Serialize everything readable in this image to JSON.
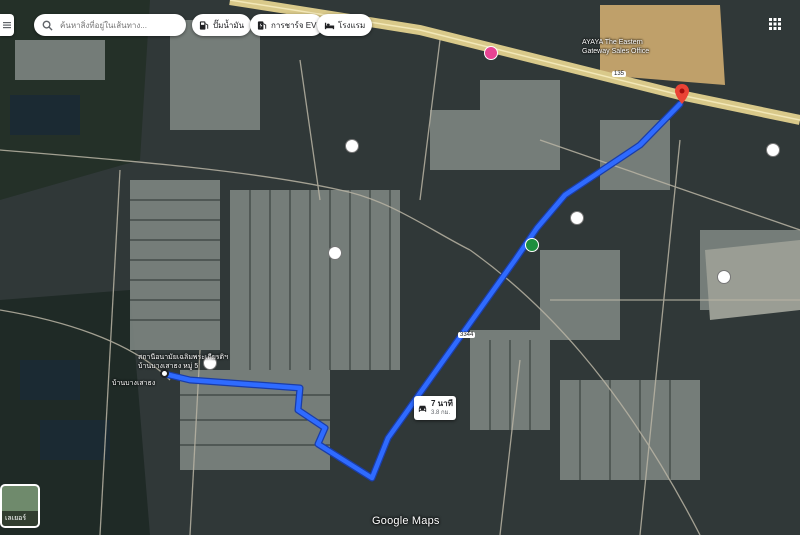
{
  "search": {
    "placeholder": "ค้นหาสิ่งที่อยู่ในเส้นทาง..."
  },
  "chips": [
    {
      "label": "ปั๊มน้ำมัน",
      "icon": "gas-station-icon"
    },
    {
      "label": "การชาร์จ EV",
      "icon": "ev-charger-icon"
    },
    {
      "label": "โรงแรม",
      "icon": "hotel-icon"
    }
  ],
  "route": {
    "duration": "7 นาที",
    "distance": "3.8 กม.",
    "color": "#2f6bff"
  },
  "labels": {
    "origin": "บ้านบางเสาธง",
    "origin_poi": "สถานีอนามัยเฉลิมพระเกียรติฯ",
    "origin_poi_sub": "บ้านบางเสาธง หมู่ 5",
    "destination_poi": "AYAYA The Eastern Gateway Sales Office",
    "highway_shield": "135",
    "road_3344": "3344"
  },
  "map_type": {
    "label": "เลเยอร์"
  },
  "logo": "Google Maps",
  "colors": {
    "accent": "#2f6bff",
    "destination_pin": "#ea4335",
    "highway": "#d9c98a"
  }
}
